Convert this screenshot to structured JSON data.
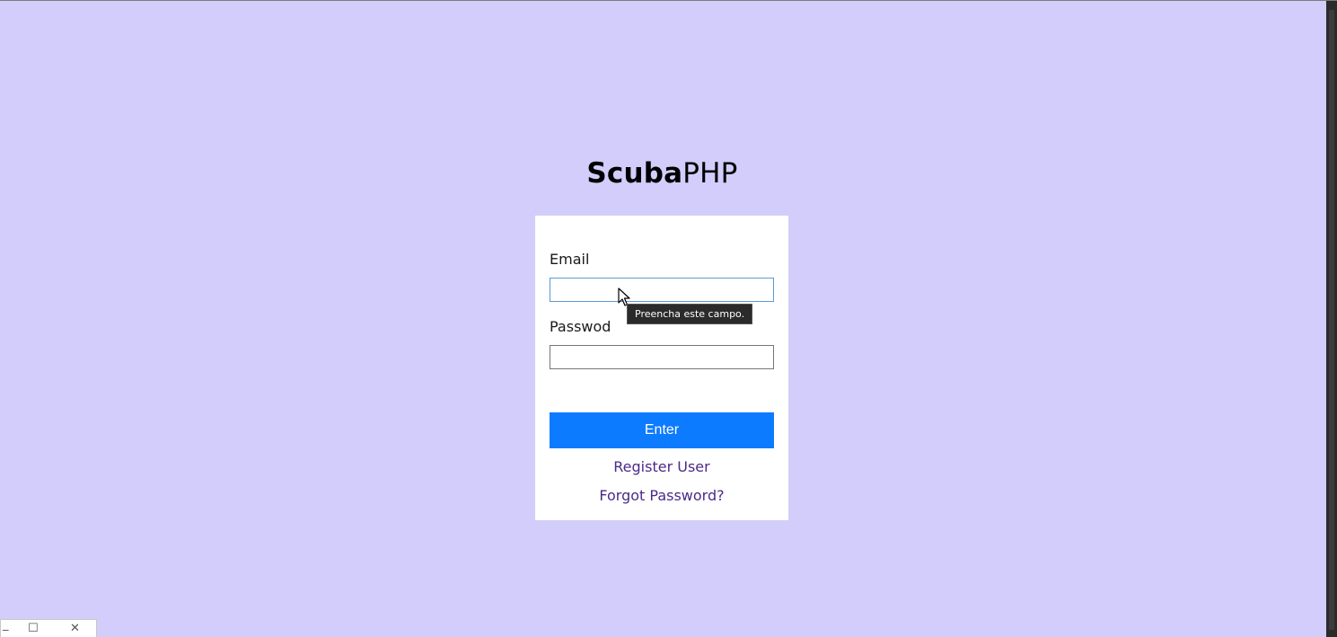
{
  "logo": {
    "bold": "Scuba",
    "light": "PHP"
  },
  "form": {
    "email_label": "Email",
    "email_value": "",
    "password_label": "Passwod",
    "password_value": "",
    "validation_tooltip": "Preencha este campo.",
    "submit_label": "Enter",
    "register_link": "Register User",
    "forgot_link": "Forgot Password?"
  },
  "window_controls": {
    "minimize": "_",
    "maximize": "☐",
    "close": "✕"
  },
  "colors": {
    "background": "#d3cdfb",
    "card": "#ffffff",
    "primary_button": "#0d7bff",
    "link": "#4b2a8a",
    "focus_border": "#5b9bd5"
  }
}
